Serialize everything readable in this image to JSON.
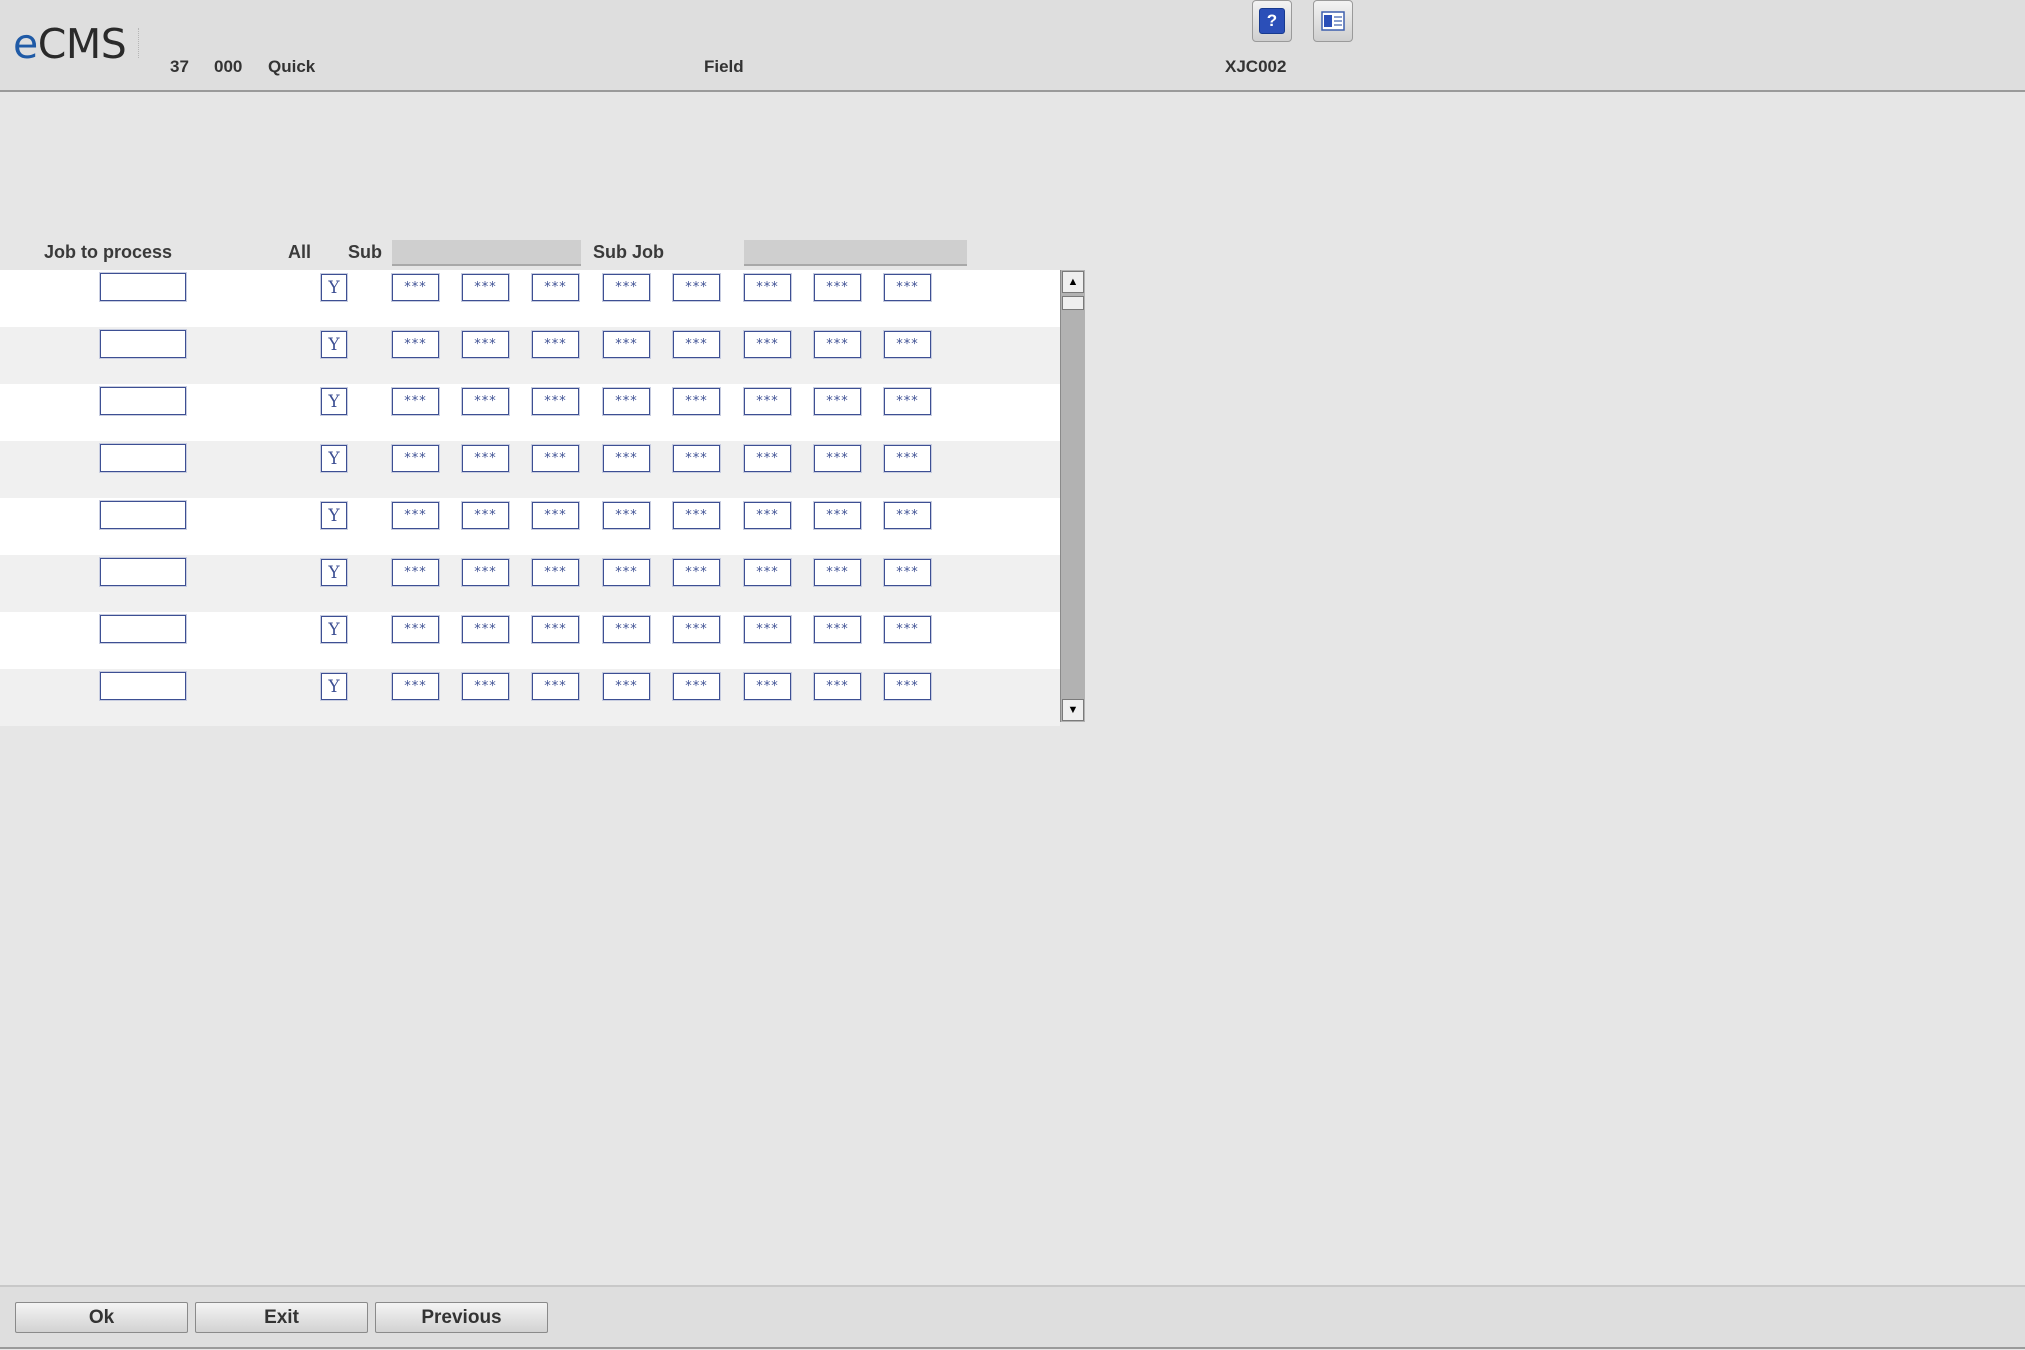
{
  "header": {
    "logo_e": "e",
    "logo_rest": "CMS",
    "company": "37",
    "division": "000",
    "menu": "Quick",
    "context": "Field",
    "program_id": "XJC002",
    "help_icon": "help-icon",
    "export_icon": "export-icon"
  },
  "grid": {
    "headers": {
      "job": "Job to process",
      "all": "All",
      "sub": "Sub",
      "sub_job": "Sub Job"
    },
    "rows": [
      {
        "job": "",
        "all": "Y",
        "subs": [
          "***",
          "***",
          "***",
          "***",
          "***",
          "***",
          "***",
          "***"
        ]
      },
      {
        "job": "",
        "all": "Y",
        "subs": [
          "***",
          "***",
          "***",
          "***",
          "***",
          "***",
          "***",
          "***"
        ]
      },
      {
        "job": "",
        "all": "Y",
        "subs": [
          "***",
          "***",
          "***",
          "***",
          "***",
          "***",
          "***",
          "***"
        ]
      },
      {
        "job": "",
        "all": "Y",
        "subs": [
          "***",
          "***",
          "***",
          "***",
          "***",
          "***",
          "***",
          "***"
        ]
      },
      {
        "job": "",
        "all": "Y",
        "subs": [
          "***",
          "***",
          "***",
          "***",
          "***",
          "***",
          "***",
          "***"
        ]
      },
      {
        "job": "",
        "all": "Y",
        "subs": [
          "***",
          "***",
          "***",
          "***",
          "***",
          "***",
          "***",
          "***"
        ]
      },
      {
        "job": "",
        "all": "Y",
        "subs": [
          "***",
          "***",
          "***",
          "***",
          "***",
          "***",
          "***",
          "***"
        ]
      },
      {
        "job": "",
        "all": "Y",
        "subs": [
          "***",
          "***",
          "***",
          "***",
          "***",
          "***",
          "***",
          "***"
        ]
      }
    ]
  },
  "footer": {
    "ok": "Ok",
    "exit": "Exit",
    "previous": "Previous"
  },
  "colors": {
    "field_border": "#3d4f93",
    "logo_e": "#1f5aa6",
    "help_blue": "#2b4fb8"
  }
}
